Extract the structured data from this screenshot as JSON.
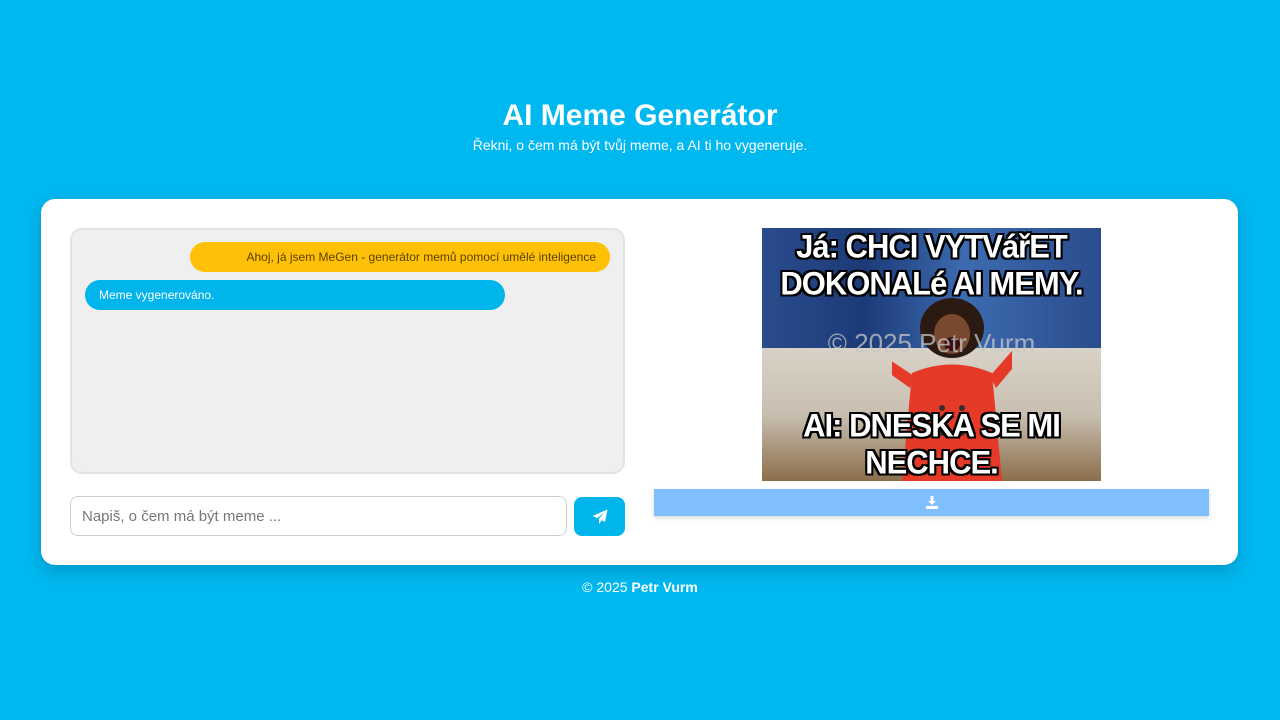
{
  "header": {
    "title": "AI Meme Generátor",
    "subtitle": "Řekni, o čem má být tvůj meme, a AI ti ho vygeneruje."
  },
  "chat": {
    "messages": [
      {
        "text": "Ahoj, já jsem MeGen - generátor memů pomocí umělé inteligence",
        "color": "#ffc107"
      },
      {
        "text": "Meme vygenerováno.",
        "color": "#00b4ec"
      }
    ]
  },
  "input": {
    "placeholder": "Napiš, o čem má být meme ...",
    "value": ""
  },
  "send_button": {
    "icon": "paper-plane-icon"
  },
  "meme": {
    "top_text": "Já: CHCI VYTVářET DOKONALé AI MEMY.",
    "bottom_text": "AI: DNESKA SE MI NECHCE.",
    "watermark": "© 2025 Petr Vurm"
  },
  "download_button": {
    "icon": "download-icon"
  },
  "footer": {
    "prefix": "© 2025",
    "author": "Petr Vurm"
  },
  "colors": {
    "background": "#00b8f0",
    "accent": "#00b4ec",
    "user_bubble": "#ffc107",
    "download": "#80bfff"
  }
}
